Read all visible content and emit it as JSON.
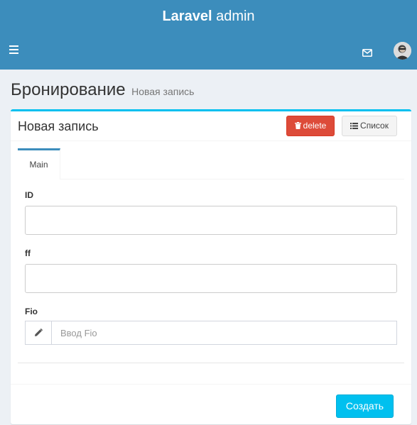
{
  "header": {
    "logo_bold": "Laravel",
    "logo_light": " admin",
    "menu_icon": "hamburger-icon",
    "mail_icon": "envelope-icon",
    "avatar_icon": "user-avatar"
  },
  "page": {
    "title": "Бронирование",
    "subtitle": "Новая запись"
  },
  "box": {
    "title": "Новая запись",
    "delete_label": "delete",
    "delete_icon": "trash-icon",
    "list_label": "Список",
    "list_icon": "list-icon"
  },
  "tabs": [
    {
      "label": "Main",
      "active": true
    }
  ],
  "form": {
    "fields": [
      {
        "label": "ID",
        "value": ""
      },
      {
        "label": "ff",
        "value": ""
      },
      {
        "label": "Fio",
        "value": "",
        "placeholder": "Ввод Fio",
        "icon": "pencil-icon"
      }
    ]
  },
  "footer": {
    "submit_label": "Создать"
  },
  "colors": {
    "header": "#3c8dbc",
    "box_accent": "#00c0ef",
    "danger": "#dd4b39",
    "primary_action": "#00c0ef",
    "background": "#ecf0f5"
  }
}
